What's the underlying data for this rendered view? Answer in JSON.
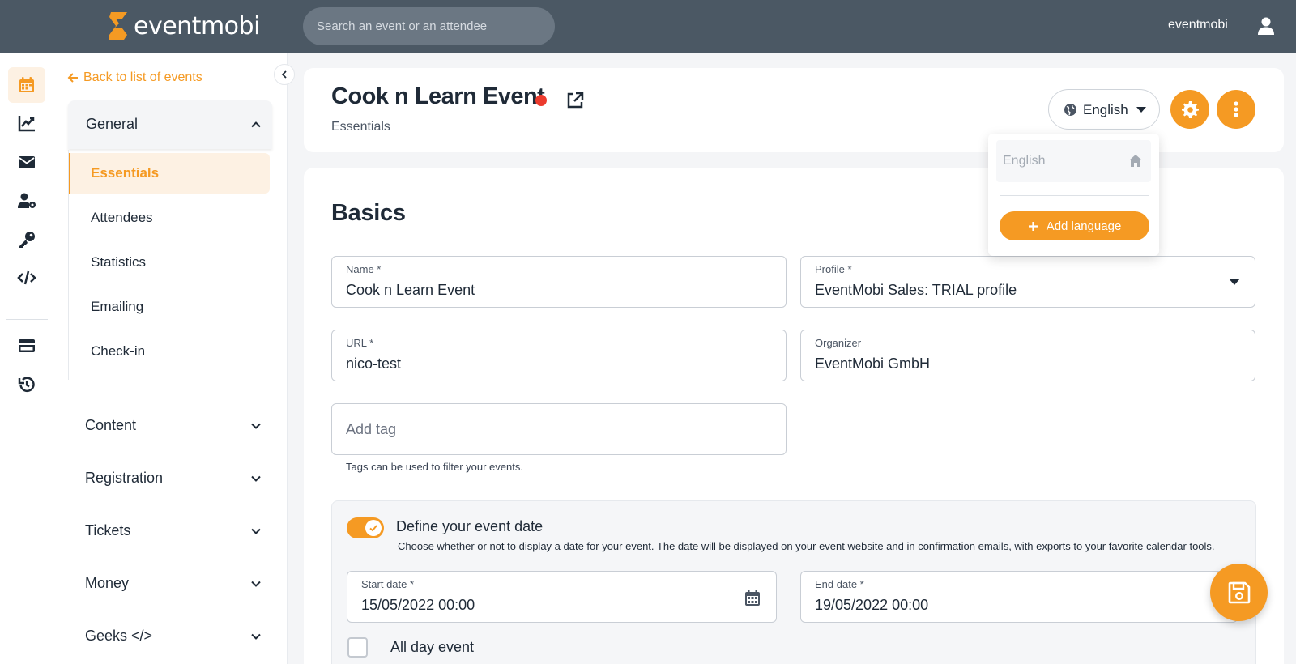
{
  "brand": {
    "name": "eventmobi",
    "accent": "#f59a23",
    "topbar_color": "#4b5864"
  },
  "search": {
    "placeholder": "Search an event or an attendee"
  },
  "user": {
    "name": "eventmobi",
    "icon": "user-icon"
  },
  "rail": {
    "items": [
      {
        "icon": "calendar-icon",
        "active": true
      },
      {
        "icon": "chart-line-icon",
        "active": false
      },
      {
        "icon": "envelope-icon",
        "active": false
      },
      {
        "icon": "user-gear-icon",
        "active": false
      },
      {
        "icon": "key-icon",
        "active": false
      },
      {
        "icon": "code-icon",
        "active": false
      },
      {
        "icon": "credit-card-icon",
        "active": false
      },
      {
        "icon": "history-icon",
        "active": false
      }
    ]
  },
  "sidenav": {
    "back_label": "Back to list of events",
    "general": {
      "label": "General",
      "items": [
        "Essentials",
        "Attendees",
        "Statistics",
        "Emailing",
        "Check-in"
      ],
      "active": "Essentials"
    },
    "groups": [
      "Content",
      "Registration",
      "Tickets",
      "Money",
      "Geeks </>"
    ]
  },
  "header": {
    "title": "Cook n Learn Event",
    "subtitle": "Essentials",
    "status_color": "#ec3b2e",
    "language": "English"
  },
  "language_menu": {
    "current": "English",
    "add_label": "Add language"
  },
  "basics": {
    "title": "Basics",
    "name": {
      "label": "Name *",
      "value": "Cook n Learn Event"
    },
    "profile": {
      "label": "Profile *",
      "value": "EventMobi Sales: TRIAL profile"
    },
    "url": {
      "label": "URL *",
      "value": "nico-test"
    },
    "organizer": {
      "label": "Organizer",
      "value": "EventMobi GmbH"
    },
    "tag": {
      "placeholder": "Add tag",
      "helper": "Tags can be used to filter your events."
    }
  },
  "event_date": {
    "title": "Define your event date",
    "description": "Choose whether or not to display a date for your event. The date will be displayed on your event website and in confirmation emails, with exports to your favorite calendar tools.",
    "enabled": true,
    "start": {
      "label": "Start date *",
      "value": "15/05/2022 00:00"
    },
    "end": {
      "label": "End date *",
      "value": "19/05/2022 00:00"
    },
    "all_day_label": "All day event",
    "all_day_checked": false
  }
}
